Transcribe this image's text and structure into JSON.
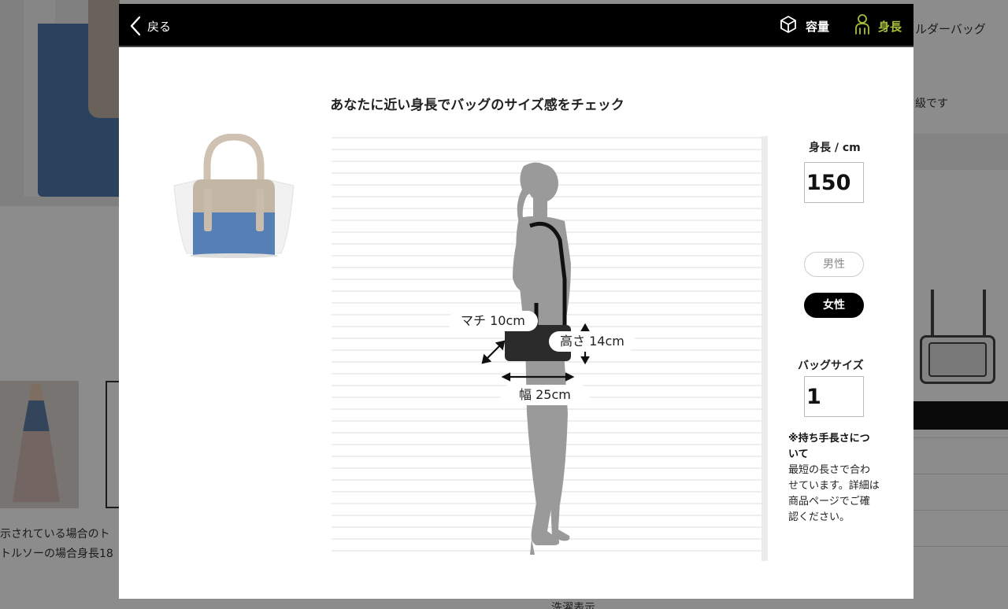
{
  "background": {
    "right_title": "ルダーバッグ",
    "right_text": "級です",
    "caption_line1": "示されている場合のト",
    "caption_line2": "トルソーの場合身長18",
    "bottom_text": "洗濯表示"
  },
  "header": {
    "back_label": "戻る",
    "capacity_label": "容量",
    "height_label": "身長",
    "active_tab_color": "#a6c03a"
  },
  "title": "あなたに近い身長でバッグのサイズ感をチェック",
  "bag": {
    "depth_label": "マチ 10cm",
    "height_label": "高さ 14cm",
    "width_label": "幅 25cm"
  },
  "controls": {
    "height_label": "身長 / cm",
    "height_value": "150",
    "male_label": "男性",
    "female_label": "女性",
    "selected_gender": "female",
    "bag_size_label": "バッグサイズ",
    "bag_size_value": "1",
    "note_title": "※持ち手長さについて",
    "note_body": "最短の長さで合わせています。詳細は商品ページでご確認ください。"
  },
  "icons": {
    "back": "chevron-left-icon",
    "capacity": "cube-icon",
    "height": "person-icon"
  }
}
